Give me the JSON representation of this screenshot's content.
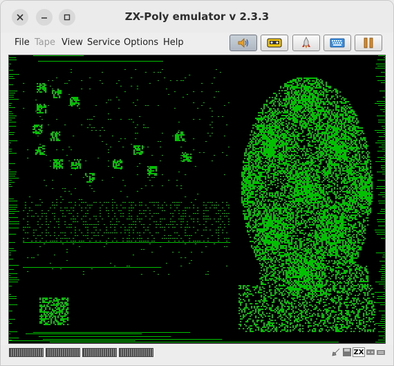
{
  "window": {
    "title": "ZX-Poly emulator v 2.3.3"
  },
  "menu": {
    "file": "File",
    "tape": "Tape",
    "view": "View",
    "service": "Service",
    "options": "Options",
    "help": "Help"
  },
  "toolbar": {
    "sound": "speaker-icon",
    "tape": "cassette-icon",
    "turbo": "rocket-icon",
    "keyboard": "keyboard-icon",
    "pause": "pause-icon"
  },
  "screen": {
    "border_color": "#000000",
    "ink_color": "#00c000",
    "paper_color": "#000000"
  },
  "status": {
    "zx_label": "ZX"
  }
}
